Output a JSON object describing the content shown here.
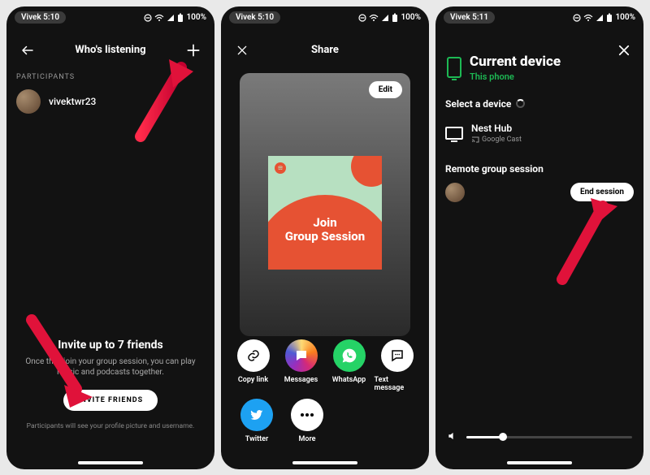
{
  "status": {
    "left_pill_a": "Vivek 5:10",
    "left_pill_b": "Vivek 5:10",
    "left_pill_c": "Vivek 5:11",
    "battery": "100%"
  },
  "screen1": {
    "title": "Who's listening",
    "participants_label": "PARTICIPANTS",
    "participant_name": "vivektwr23",
    "invite_title": "Invite up to 7 friends",
    "invite_sub": "Once they join your group session, you can play music and podcasts together.",
    "invite_button": "INVITE FRIENDS",
    "invite_note": "Participants will see your profile picture and username."
  },
  "screen2": {
    "title": "Share",
    "edit": "Edit",
    "album_line1": "Join",
    "album_line2": "Group Session",
    "share_items": {
      "copy": "Copy link",
      "messages": "Messages",
      "whatsapp": "WhatsApp",
      "text": "Text message",
      "twitter": "Twitter",
      "more": "More"
    }
  },
  "screen3": {
    "title": "Current device",
    "subtitle": "This phone",
    "select_label": "Select a device",
    "device_name": "Nest Hub",
    "device_cast": "Google Cast",
    "remote_label": "Remote group session",
    "end_session": "End session"
  }
}
